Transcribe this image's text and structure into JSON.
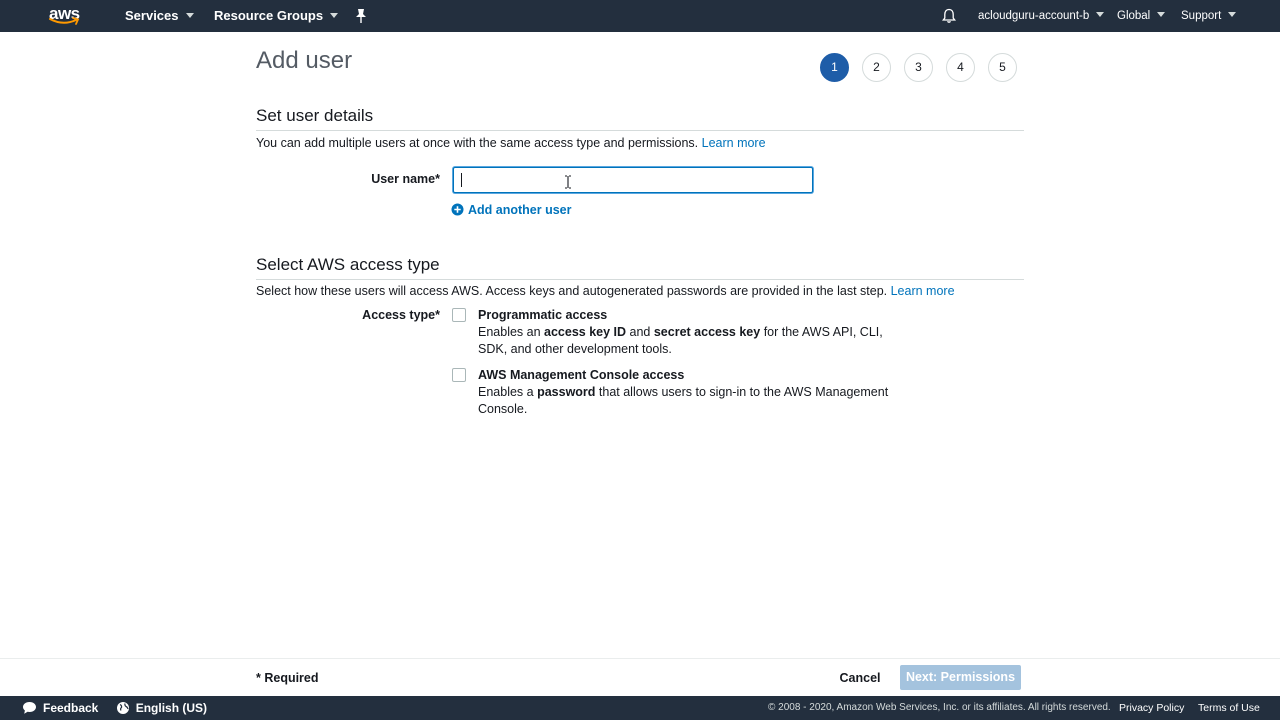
{
  "nav": {
    "brand": "aws",
    "services_label": "Services",
    "resource_groups_label": "Resource Groups",
    "account_label": "acloudguru-account-b",
    "region_label": "Global",
    "support_label": "Support",
    "icons": [
      "pin-icon",
      "bell-icon"
    ]
  },
  "page": {
    "title": "Add user",
    "steps": [
      "1",
      "2",
      "3",
      "4",
      "5"
    ],
    "active_step": 1
  },
  "user_details": {
    "section_title": "Set user details",
    "description": "You can add multiple users at once with the same access type and permissions.",
    "learn_more": "Learn more",
    "username_label": "User name*",
    "username_value": "",
    "add_another_user": "Add another user"
  },
  "access_type": {
    "section_title": "Select AWS access type",
    "description": "Select how these users will access AWS. Access keys and autogenerated passwords are provided in the last step.",
    "learn_more": "Learn more",
    "label": "Access type*",
    "programmatic": {
      "title": "Programmatic access",
      "desc_1": "Enables an ",
      "desc_bold_1": "access key ID",
      "desc_2": " and ",
      "desc_bold_2": "secret access key",
      "desc_3": " for the AWS API, CLI, SDK, and other development tools.",
      "checked": false
    },
    "console": {
      "title": "AWS Management Console access",
      "desc_1": "Enables a ",
      "desc_bold_1": "password",
      "desc_2": " that allows users to sign-in to the AWS Management Console.",
      "checked": false
    }
  },
  "actions": {
    "required_note": "* Required",
    "cancel": "Cancel",
    "next": "Next: Permissions"
  },
  "footer": {
    "feedback": "Feedback",
    "language": "English (US)",
    "copyright": "© 2008 - 2020, Amazon Web Services, Inc. or its affiliates. All rights reserved.",
    "privacy": "Privacy Policy",
    "terms": "Terms of Use"
  },
  "colors": {
    "nav_bg": "#232f3e",
    "link": "#0073bb",
    "active_step": "#1e5da8",
    "primary_disabled": "#a4c3de"
  }
}
